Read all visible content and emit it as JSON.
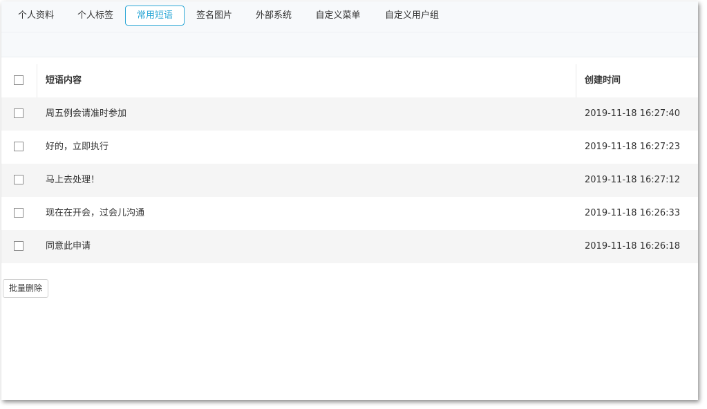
{
  "tabs": [
    {
      "label": "个人资料"
    },
    {
      "label": "个人标签"
    },
    {
      "label": "常用短语",
      "active": true
    },
    {
      "label": "签名图片"
    },
    {
      "label": "外部系统"
    },
    {
      "label": "自定义菜单"
    },
    {
      "label": "自定义用户组"
    }
  ],
  "table": {
    "headers": {
      "content": "短语内容",
      "created": "创建时间"
    },
    "rows": [
      {
        "content": "周五例会请准时参加",
        "created": "2019-11-18 16:27:40"
      },
      {
        "content": "好的，立即执行",
        "created": "2019-11-18 16:27:23"
      },
      {
        "content": "马上去处理！",
        "created": "2019-11-18 16:27:12"
      },
      {
        "content": "现在在开会，过会儿沟通",
        "created": "2019-11-18 16:26:33"
      },
      {
        "content": "同意此申请",
        "created": "2019-11-18 16:26:18"
      }
    ]
  },
  "actions": {
    "batch_delete": "批量删除"
  },
  "colors": {
    "accent": "#2ba7d6",
    "row_stripe": "#f5f5f5",
    "tabbar_bg": "#f7f9fb"
  }
}
